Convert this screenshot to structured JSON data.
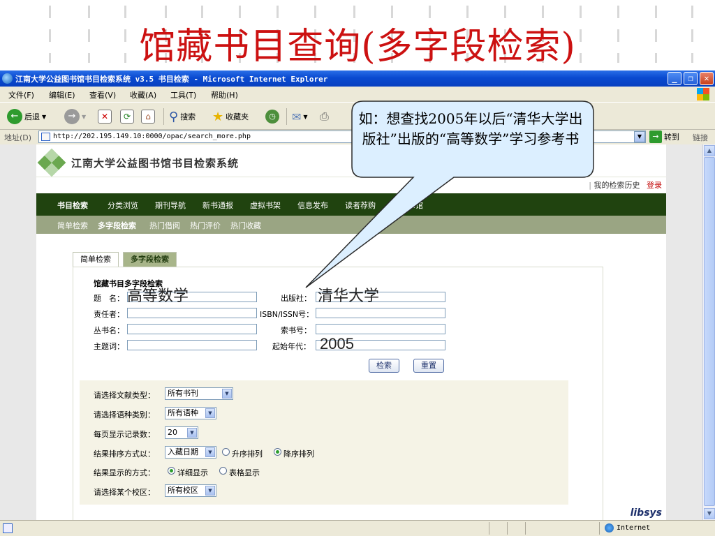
{
  "slide": {
    "title": "馆藏书目查询(多字段检索)"
  },
  "window": {
    "title": "江南大学公益图书馆书目检索系统 v3.5 书目检索 - Microsoft Internet Explorer"
  },
  "menu": [
    "文件(F)",
    "编辑(E)",
    "查看(V)",
    "收藏(A)",
    "工具(T)",
    "帮助(H)"
  ],
  "toolbar": {
    "back_label": "后退",
    "search_label": "搜索",
    "favorites_label": "收藏夹"
  },
  "address": {
    "label": "地址(D)",
    "url": "http://202.195.149.10:0000/opac/search_more.php",
    "go_label": "转到",
    "links_label": "链接"
  },
  "library": {
    "name": "江南大学公益图书馆书目检索系统",
    "history_link": "我的检索历史",
    "login_link": "登录",
    "main_nav": [
      "书目检索",
      "分类浏览",
      "期刊导航",
      "新书通报",
      "虚拟书架",
      "信息发布",
      "读者荐购",
      "我的书馆"
    ],
    "sub_nav": [
      "简单检索",
      "多字段检索",
      "热门借阅",
      "热门评价",
      "热门收藏"
    ]
  },
  "search": {
    "tabs": [
      "简单检索",
      "多字段检索"
    ],
    "caption": "馆藏书目多字段检索",
    "fields": {
      "title": "题　名：",
      "publisher": "出版社：",
      "author": "责任者：",
      "isbn": "ISBN/ISSN号：",
      "series": "丛书名：",
      "callno": "索书号：",
      "subject": "主题词：",
      "year": "起始年代："
    },
    "search_button": "检索",
    "reset_button": "重置",
    "typed_title": "高等数学",
    "typed_publisher": "清华大学",
    "typed_year": "2005"
  },
  "options": {
    "doc_type_label": "请选择文献类型：",
    "doc_type_value": "所有书刊",
    "lang_label": "请选择语种类别：",
    "lang_value": "所有语种",
    "per_page_label": "每页显示记录数：",
    "per_page_value": "20",
    "sort_label": "结果排序方式以：",
    "sort_value": "入藏日期",
    "sort_asc": "升序排列",
    "sort_desc": "降序排列",
    "display_label": "结果显示的方式：",
    "display_detail": "详细显示",
    "display_table": "表格显示",
    "campus_label": "请选择某个校区：",
    "campus_value": "所有校区"
  },
  "footer": {
    "brand": "libsys"
  },
  "status": {
    "zone": "Internet"
  },
  "callout": {
    "text": "如：想查找2005年以后“清华大学出版社”出版的“高等数学”学习参考书"
  },
  "colors": {
    "title_red": "#cc1111",
    "nav_green": "#20430f",
    "subnav_olive": "#9aa583",
    "login_red": "#c00000"
  }
}
